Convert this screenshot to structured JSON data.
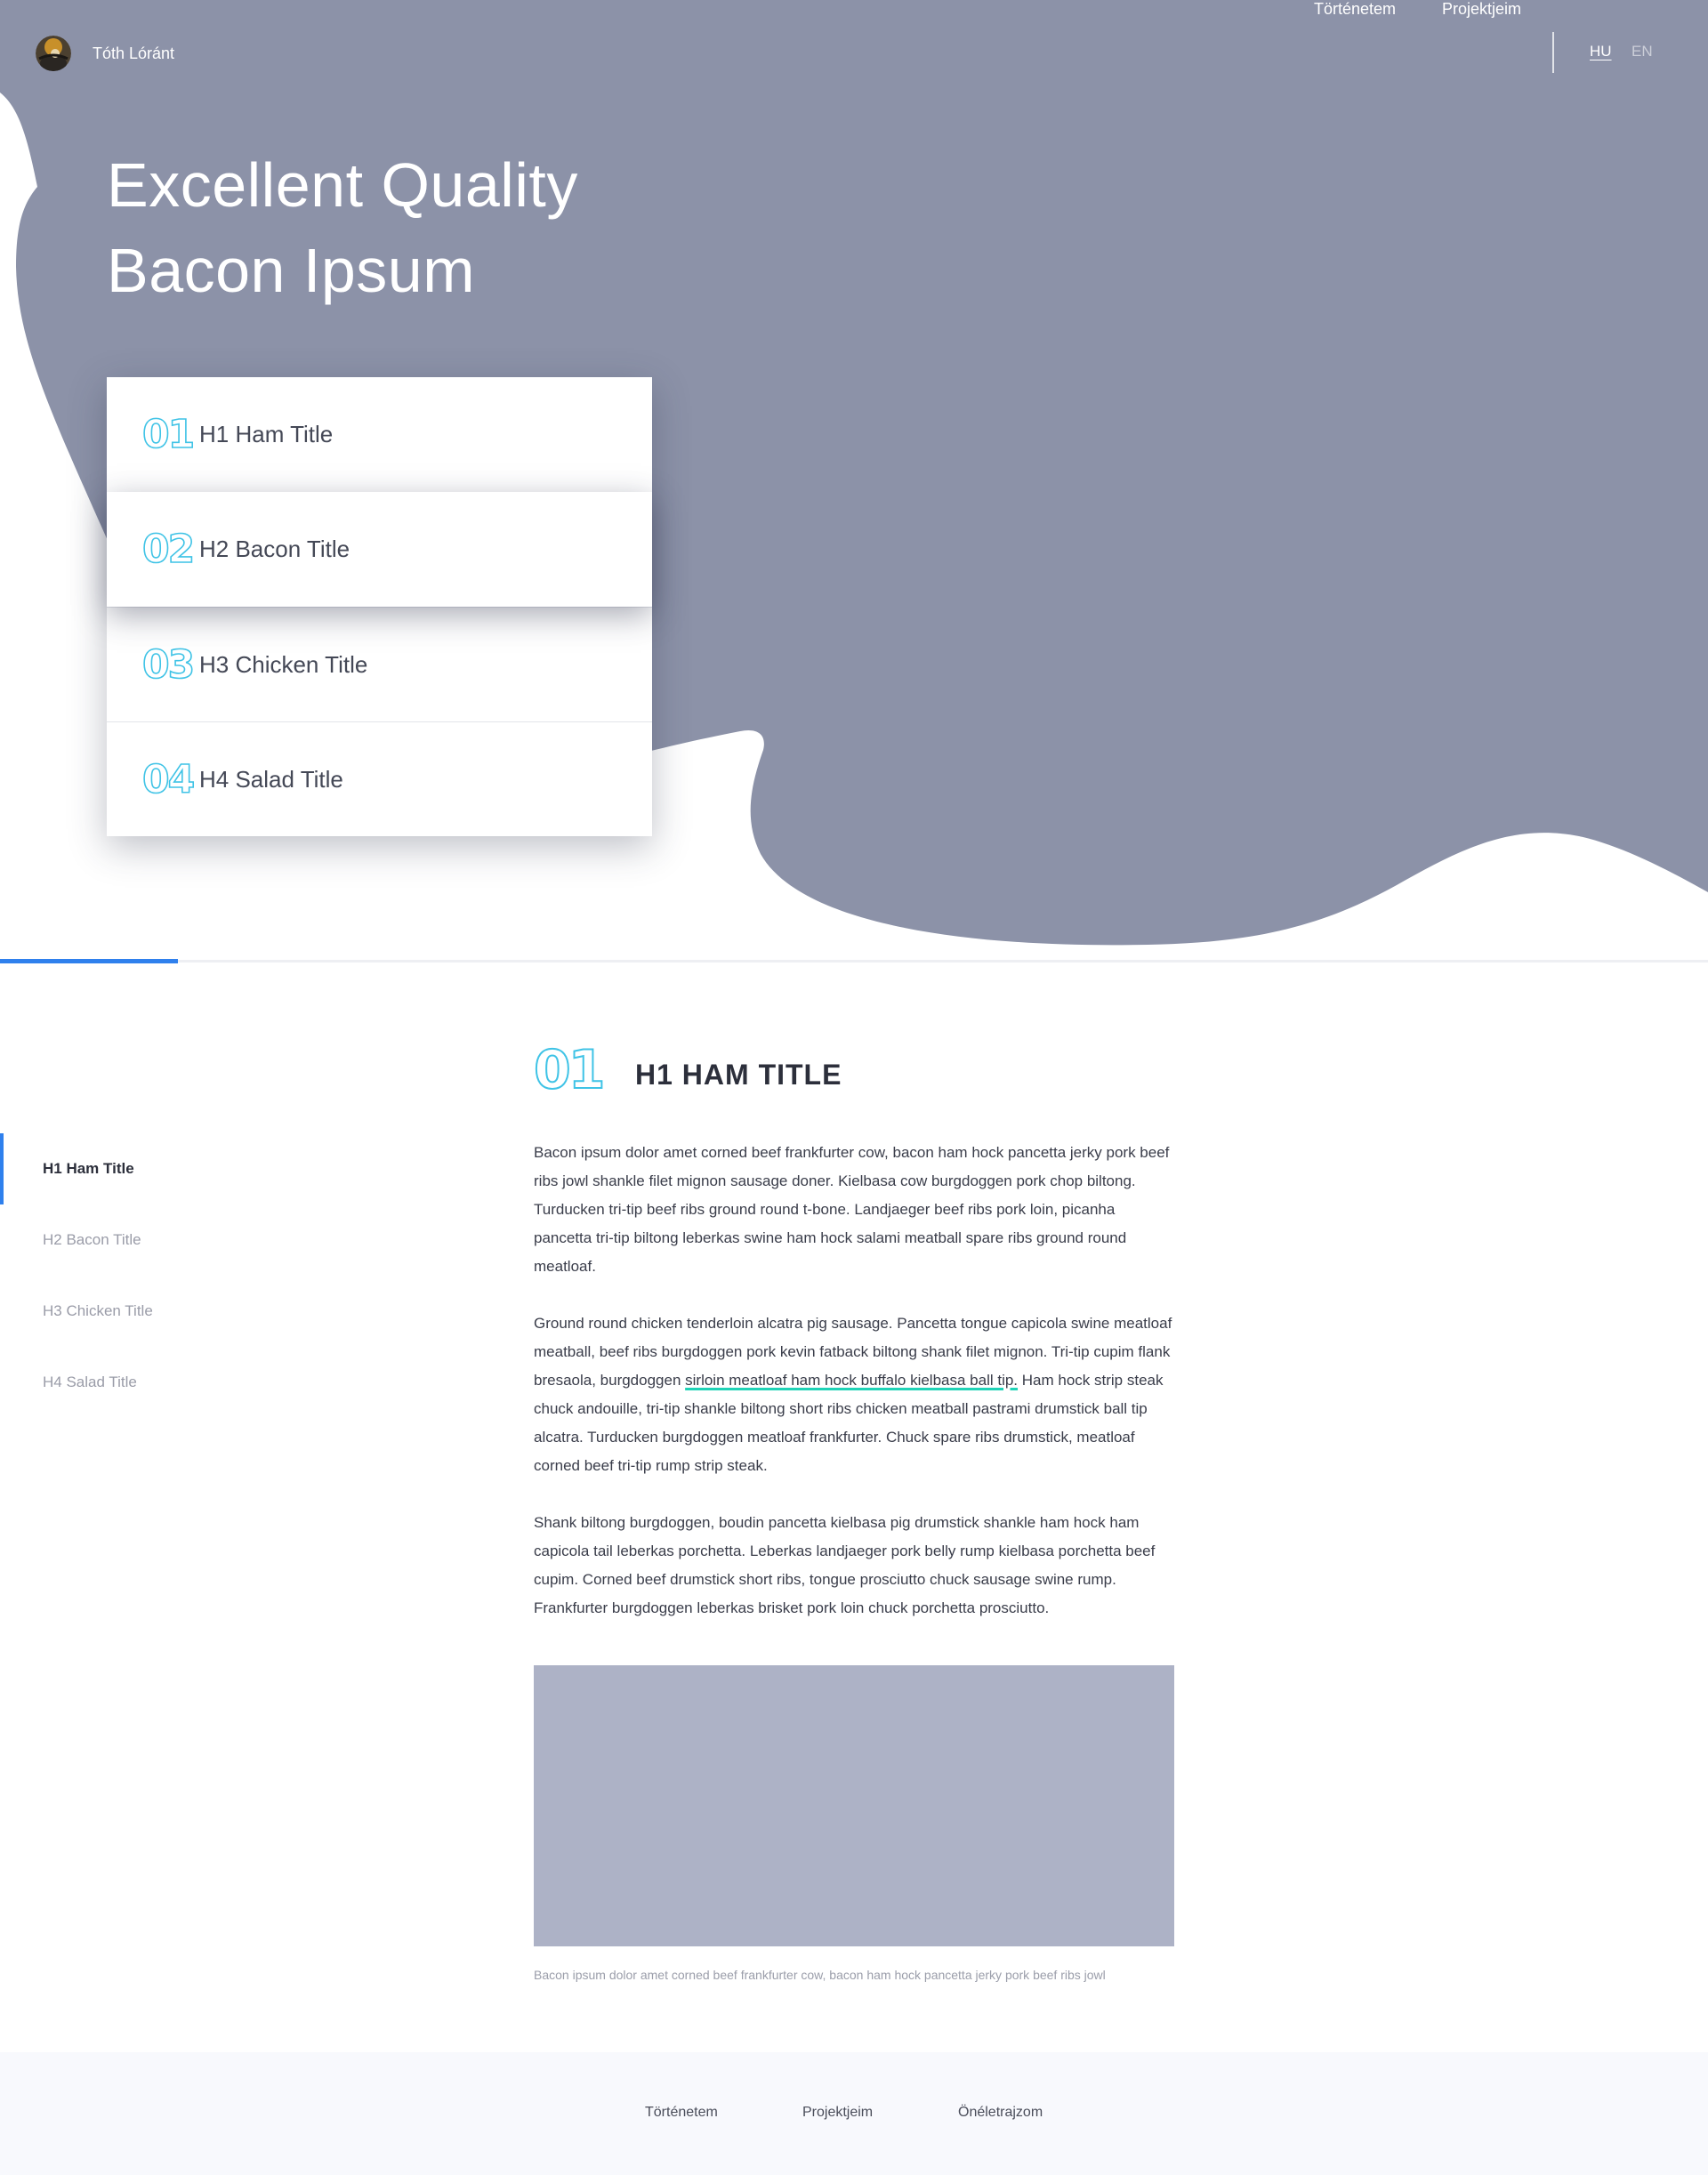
{
  "colors": {
    "hero_bg": "#8c92a8",
    "accent_blue": "#2f80ed",
    "accent_cyan": "#3fc3e6",
    "link_underline": "#1fd3b7",
    "image_placeholder": "#adb2c6",
    "footer_bg": "#f8f9fd"
  },
  "header": {
    "brand_name": "Tóth Lóránt",
    "avatar_icon": "avatar-photo",
    "nav": [
      {
        "label": "Történetem"
      },
      {
        "label": "Projektjeim"
      }
    ],
    "languages": [
      {
        "label": "HU",
        "active": true
      },
      {
        "label": "EN",
        "active": false
      }
    ]
  },
  "hero": {
    "title_line1": "Excellent Quality",
    "title_line2": "Bacon Ipsum",
    "toc": [
      {
        "num": "01",
        "label": "H1 Ham Title",
        "active": false
      },
      {
        "num": "02",
        "label": "H2 Bacon Title",
        "active": true
      },
      {
        "num": "03",
        "label": "H3 Chicken Title",
        "active": false
      },
      {
        "num": "04",
        "label": "H4 Salad Title",
        "active": false
      }
    ]
  },
  "progress": {
    "fraction": 0.104
  },
  "sidebar": {
    "items": [
      {
        "label": "H1 Ham Title",
        "active": true
      },
      {
        "label": "H2 Bacon Title",
        "active": false
      },
      {
        "label": "H3 Chicken Title",
        "active": false
      },
      {
        "label": "H4 Salad Title",
        "active": false
      }
    ]
  },
  "article": {
    "num": "01",
    "title": "H1 HAM TITLE",
    "p1": "Bacon ipsum dolor amet corned beef frankfurter cow, bacon ham hock pancetta jerky pork beef ribs jowl shankle filet mignon sausage doner. Kielbasa cow burgdoggen pork chop biltong. Turducken tri-tip beef ribs ground round t-bone. Landjaeger beef ribs pork loin, picanha pancetta tri-tip biltong leberkas swine ham hock salami meatball spare ribs ground round meatloaf.",
    "p2_before": "Ground round chicken tenderloin alcatra pig sausage. Pancetta tongue capicola swine meatloaf meatball, beef ribs burgdoggen pork kevin fatback biltong shank filet mignon. Tri-tip cupim flank bresaola, burgdoggen ",
    "p2_link": "sirloin meatloaf ham hock buffalo kielbasa ball tip.",
    "p2_after": " Ham hock strip steak chuck andouille, tri-tip shankle biltong short ribs chicken meatball pastrami drumstick ball tip alcatra. Turducken burgdoggen meatloaf frankfurter. Chuck spare ribs drumstick, meatloaf corned beef tri-tip rump strip steak.",
    "p3": "Shank biltong burgdoggen, boudin pancetta kielbasa pig drumstick shankle ham hock ham capicola tail leberkas porchetta. Leberkas landjaeger pork belly rump kielbasa porchetta beef cupim. Corned beef drumstick short ribs, tongue prosciutto chuck sausage swine rump. Frankfurter burgdoggen leberkas brisket pork loin chuck porchetta prosciutto.",
    "caption": "Bacon ipsum dolor amet corned beef frankfurter cow, bacon ham hock pancetta jerky pork beef ribs jowl"
  },
  "footer": {
    "links": [
      {
        "label": "Történetem"
      },
      {
        "label": "Projektjeim"
      },
      {
        "label": "Önéletrajzom"
      }
    ]
  }
}
